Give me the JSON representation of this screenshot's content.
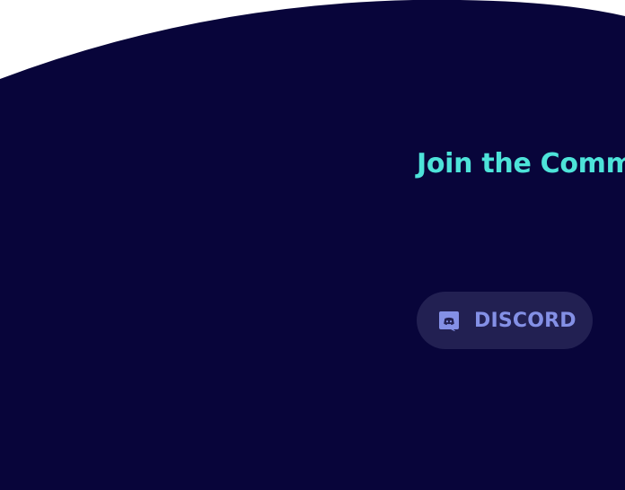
{
  "colors": {
    "page_background": "#ffffff",
    "hero_background": "#08053a",
    "headline": "#4de3d9",
    "button_background": "#222052",
    "button_foreground": "#8490e6"
  },
  "community": {
    "heading": "Join the Community"
  },
  "discord_button": {
    "icon": "discord-icon",
    "label": "DISCORD"
  }
}
